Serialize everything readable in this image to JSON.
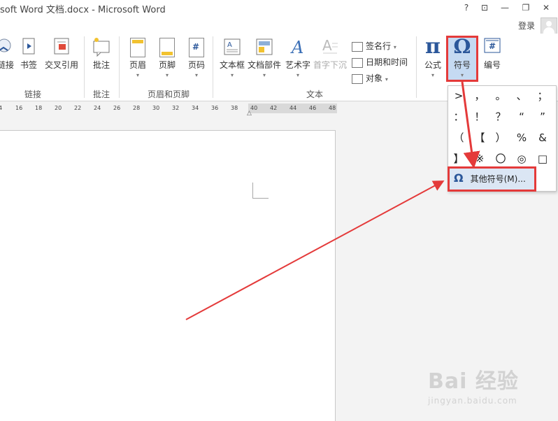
{
  "window": {
    "title": "soft Word 文档.docx - Microsoft Word",
    "help": "?",
    "restore_ribbon": "⊡",
    "minimize": "—",
    "maximize": "❐",
    "close": "✕",
    "login": "登录"
  },
  "ribbon": {
    "links_group": {
      "label": "链接",
      "buttons": [
        "链接",
        "书签",
        "交叉引用"
      ]
    },
    "comments_group": {
      "label": "批注",
      "buttons": [
        "批注"
      ]
    },
    "header_footer_group": {
      "label": "页眉和页脚",
      "buttons": [
        "页眉",
        "页脚",
        "页码"
      ]
    },
    "text_group": {
      "label": "文本",
      "buttons": [
        "文本框",
        "文档部件",
        "艺术字",
        "首字下沉"
      ],
      "small": [
        "签名行",
        "日期和时间",
        "对象"
      ]
    },
    "symbols_group": {
      "buttons": [
        "公式",
        "符号",
        "编号"
      ]
    }
  },
  "ruler": {
    "ticks": [
      "4",
      "16",
      "18",
      "20",
      "22",
      "24",
      "26",
      "28",
      "30",
      "32",
      "34",
      "36",
      "38",
      "40",
      "42",
      "44",
      "46",
      "48"
    ]
  },
  "symbol_panel": {
    "symbols": [
      ">",
      "，",
      "。",
      "、",
      "；",
      "：",
      "！",
      "？",
      "“",
      "”",
      "（",
      "【",
      "）",
      "%",
      "&",
      "】",
      "※",
      "〇",
      "◎",
      "□"
    ],
    "more": "其他符号(M)..."
  },
  "icons": {
    "omega": "Ω",
    "pi": "π",
    "hash": "#"
  },
  "colors": {
    "highlight_red": "#e43a3a",
    "word_blue": "#2b579a",
    "selected_bg": "#c5daf2"
  },
  "watermark": {
    "main": "Bai 经验",
    "sub": "jingyan.baidu.com"
  }
}
